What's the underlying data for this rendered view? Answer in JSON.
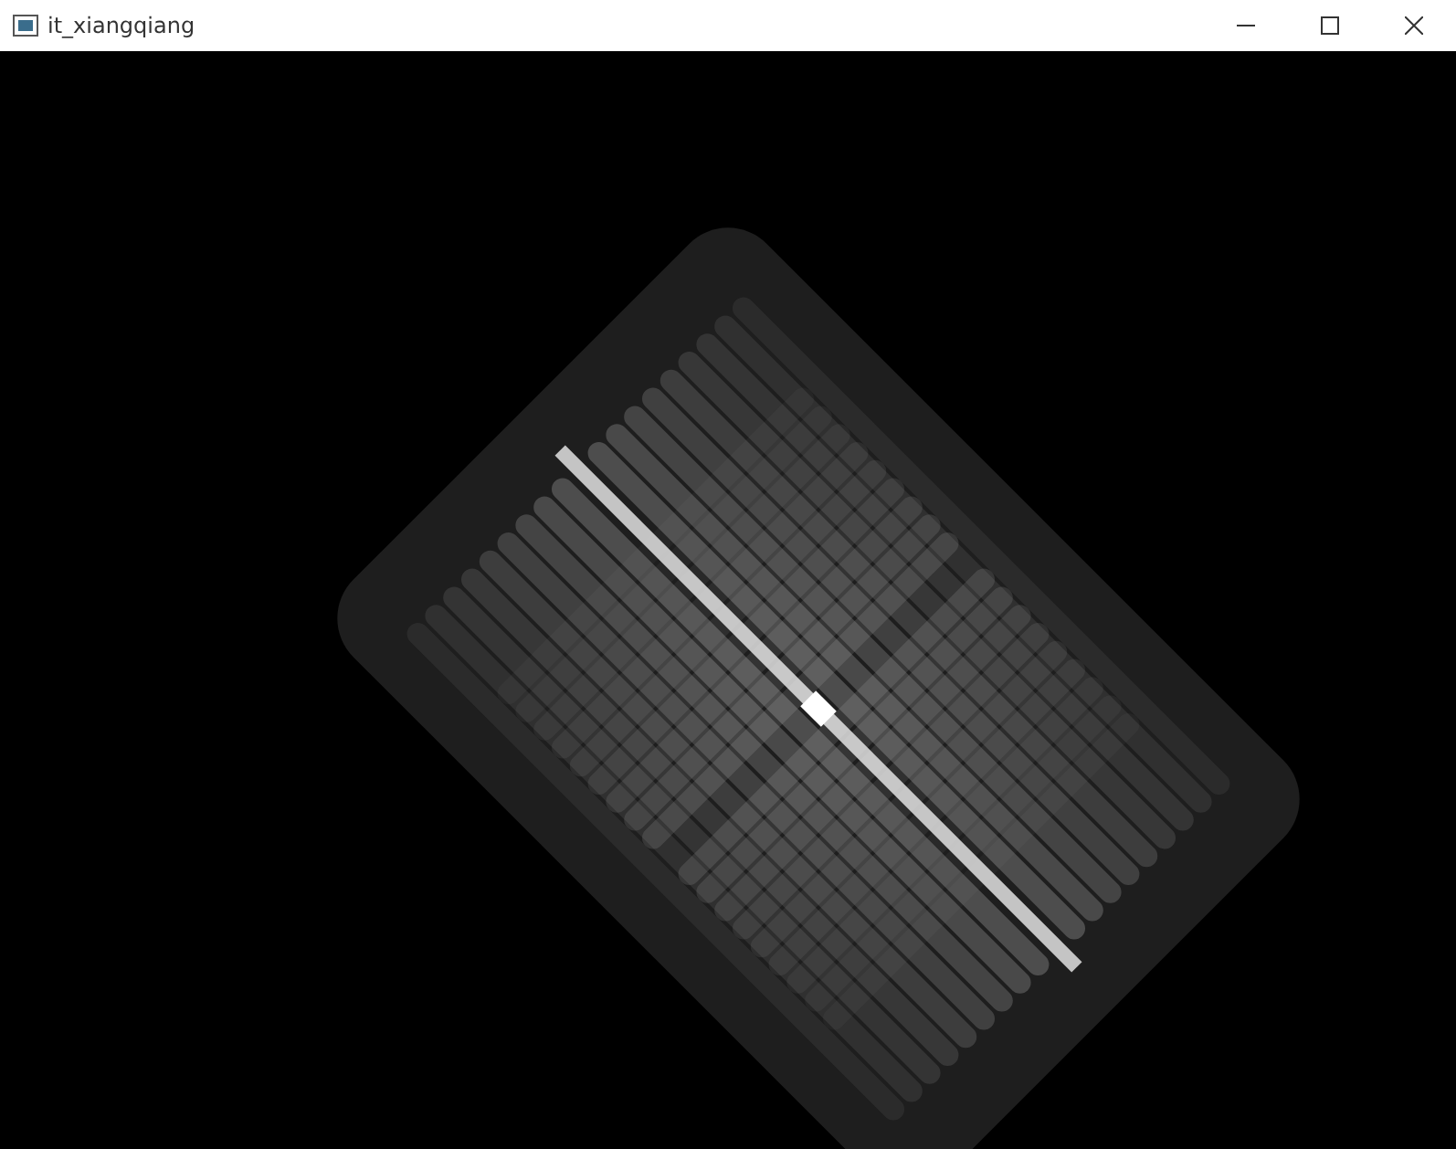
{
  "window": {
    "title": "it_xiangqiang"
  }
}
